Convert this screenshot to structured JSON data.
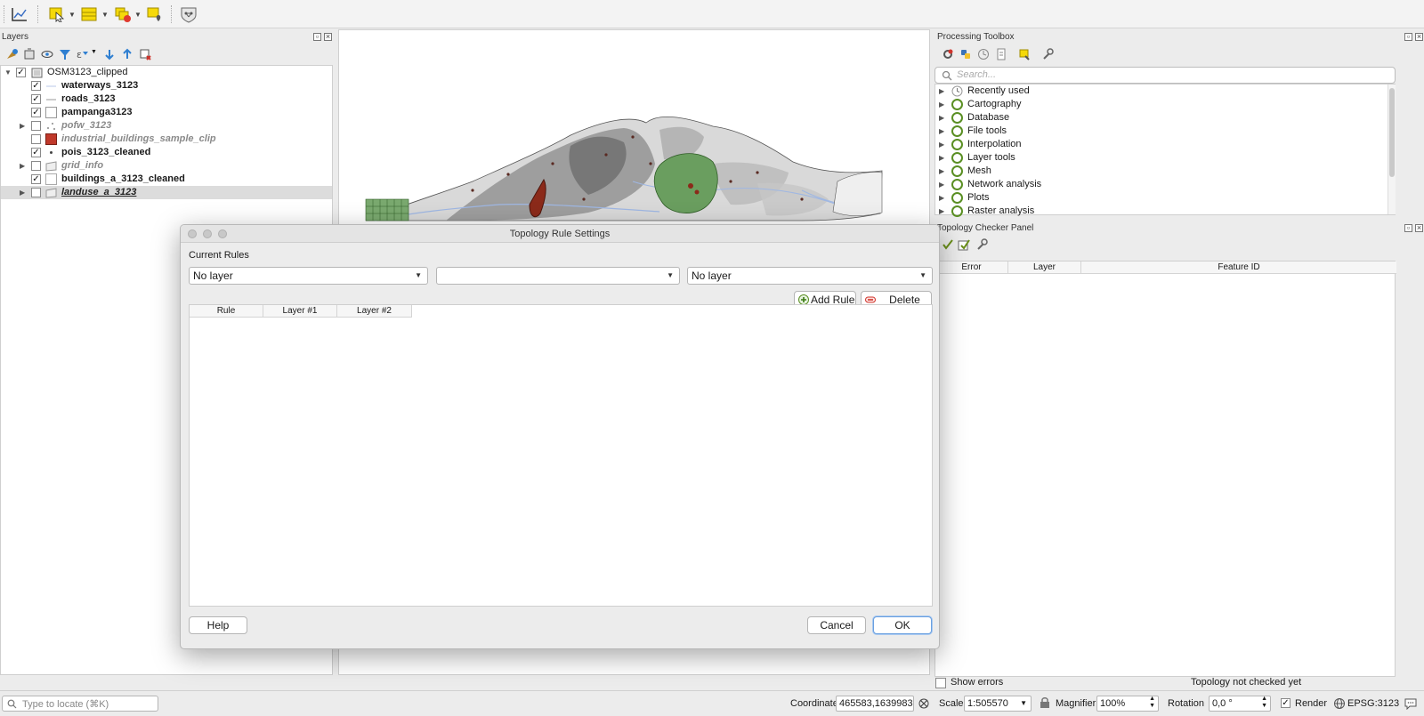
{
  "toolbar": {
    "icons": [
      "plot-icon",
      "select-features-icon",
      "attribute-table-icon",
      "deselect-icon",
      "label-pin-icon",
      "topology-checker-icon"
    ]
  },
  "layers_panel": {
    "title": "Layers",
    "group": {
      "name": "OSM3123_clipped",
      "checked": true
    },
    "layers": [
      {
        "name": "waterways_3123",
        "checked": true,
        "style": "bold"
      },
      {
        "name": "roads_3123",
        "checked": true,
        "style": "bold"
      },
      {
        "name": "pampanga3123",
        "checked": true,
        "style": "bold"
      },
      {
        "name": "pofw_3123",
        "checked": false,
        "style": "italic-gray",
        "expandable": true
      },
      {
        "name": "industrial_buildings_sample_clip",
        "checked": false,
        "style": "italic-gray",
        "swatch": "#c0392b"
      },
      {
        "name": "pois_3123_cleaned",
        "checked": true,
        "style": "bold"
      },
      {
        "name": "grid_info",
        "checked": false,
        "style": "italic-gray",
        "expandable": true
      },
      {
        "name": "buildings_a_3123_cleaned",
        "checked": true,
        "style": "bold"
      },
      {
        "name": "landuse_a_3123",
        "checked": false,
        "style": "italic-selected",
        "expandable": true
      }
    ]
  },
  "processing_toolbox": {
    "title": "Processing Toolbox",
    "search_placeholder": "Search...",
    "items": [
      "Recently used",
      "Cartography",
      "Database",
      "File tools",
      "Interpolation",
      "Layer tools",
      "Mesh",
      "Network analysis",
      "Plots",
      "Raster analysis"
    ]
  },
  "topology_panel": {
    "title": "Topology Checker Panel",
    "columns": [
      "Error",
      "Layer",
      "Feature ID"
    ],
    "show_errors_label": "Show errors",
    "status": "Topology not checked yet"
  },
  "dialog": {
    "title": "Topology Rule Settings",
    "section_label": "Current Rules",
    "combo1": "No layer",
    "combo2": "",
    "combo3": "No layer",
    "add_rule": "Add Rule",
    "delete_rule": "Delete Rule",
    "columns": [
      "Rule",
      "Layer #1",
      "Layer #2"
    ],
    "help": "Help",
    "cancel": "Cancel",
    "ok": "OK"
  },
  "statusbar": {
    "locate_placeholder": "Type to locate (⌘K)",
    "coordinate_label": "Coordinate",
    "coordinate_value": "465583,1639983",
    "scale_label": "Scale",
    "scale_value": "1:505570",
    "magnifier_label": "Magnifier",
    "magnifier_value": "100%",
    "rotation_label": "Rotation",
    "rotation_value": "0,0 °",
    "render_label": "Render",
    "render_checked": true,
    "crs": "EPSG:3123"
  },
  "colors": {
    "accent": "#5a8f23",
    "map_green": "#6a9e5f",
    "map_red": "#8b2a1a"
  }
}
